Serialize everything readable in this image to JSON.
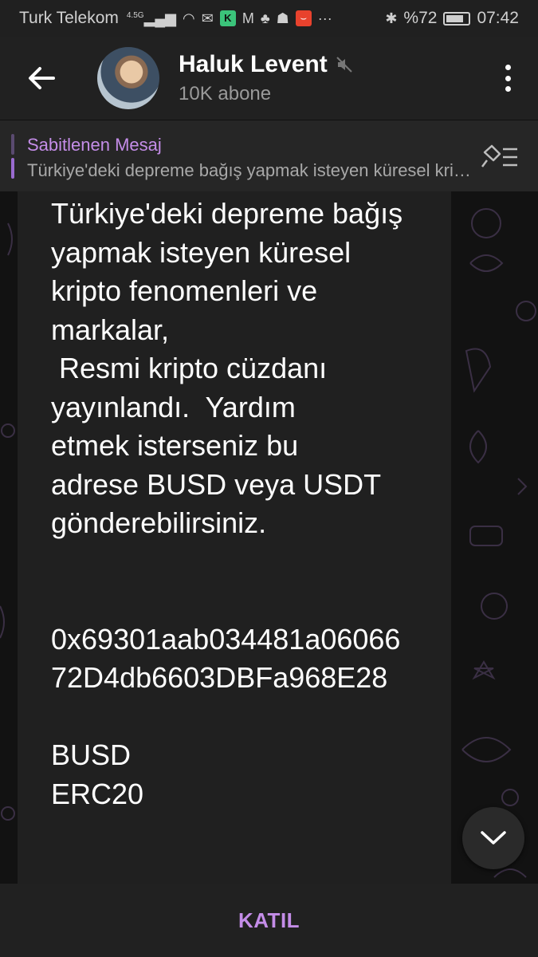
{
  "status_bar": {
    "carrier": "Turk Telekom",
    "network": "4.5G",
    "battery": "%72",
    "time": "07:42"
  },
  "header": {
    "title": "Haluk Levent",
    "subtitle": "10K abone"
  },
  "pinned": {
    "label": "Sabitlenen Mesaj",
    "preview": "Türkiye'deki depreme bağış yapmak isteyen küresel kripto fenomenleri ve markalar,"
  },
  "message": {
    "text": "Türkiye'deki depreme bağış\nyapmak isteyen küresel\nkripto fenomenleri ve\nmarkalar,\n Resmi kripto cüzdanı\nyayınlandı.  Yardım\netmek isterseniz bu\nadrese BUSD veya USDT\ngönderebilirsiniz.\n\n\n0x69301aab034481a06066\n72D4db6603DBFa968E28\n\nBUSD\nERC20"
  },
  "bottom": {
    "join_label": "KATIL"
  },
  "colors": {
    "accent": "#c48de8",
    "bubble": "#202020",
    "background": "#121212"
  }
}
